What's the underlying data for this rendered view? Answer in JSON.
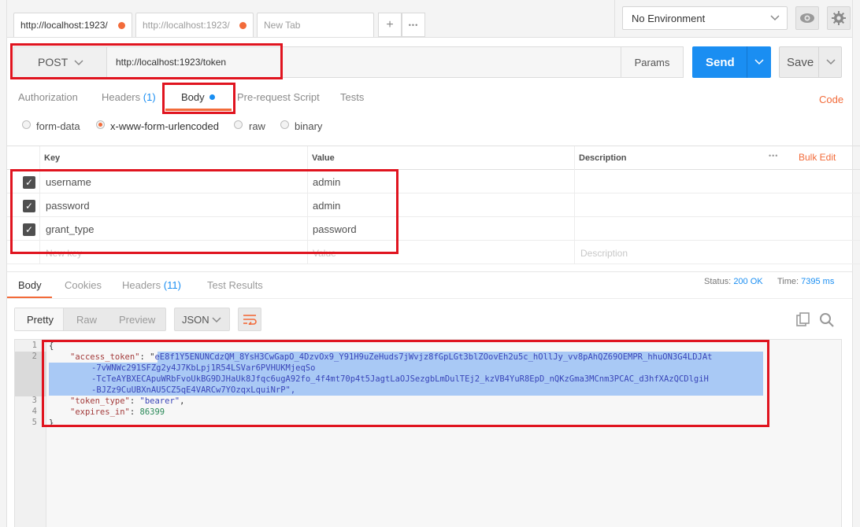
{
  "tabs": [
    {
      "label": "http://localhost:1923/",
      "modified": true
    },
    {
      "label": "http://localhost:1923/",
      "modified": true
    },
    {
      "label": "New Tab",
      "modified": false
    }
  ],
  "tab_actions": {
    "add": "+",
    "more": "•••"
  },
  "environment": {
    "selected": "No Environment"
  },
  "request": {
    "method": "POST",
    "url": "http://localhost:1923/token",
    "params_label": "Params",
    "send_label": "Send",
    "save_label": "Save"
  },
  "request_tabs": [
    {
      "label": "Authorization"
    },
    {
      "label": "Headers",
      "count": "(1)"
    },
    {
      "label": "Body"
    },
    {
      "label": "Pre-request Script"
    },
    {
      "label": "Tests"
    }
  ],
  "code_link": "Code",
  "body_types": [
    "form-data",
    "x-www-form-urlencoded",
    "raw",
    "binary"
  ],
  "body_type_selected": "x-www-form-urlencoded",
  "kv_table": {
    "headers": {
      "key": "Key",
      "value": "Value",
      "description": "Description"
    },
    "bulk_edit": "Bulk Edit",
    "more": "•••",
    "rows": [
      {
        "key": "username",
        "value": "admin",
        "checked": true
      },
      {
        "key": "password",
        "value": "admin",
        "checked": true
      },
      {
        "key": "grant_type",
        "value": "password",
        "checked": true
      }
    ],
    "placeholder": {
      "key": "New key",
      "value": "Value",
      "description": "Description"
    }
  },
  "response_tabs": [
    {
      "label": "Body"
    },
    {
      "label": "Cookies"
    },
    {
      "label": "Headers",
      "count": "(11)"
    },
    {
      "label": "Test Results"
    }
  ],
  "status": {
    "label": "Status:",
    "value": "200 OK",
    "time_label": "Time:",
    "time_value": "7395 ms"
  },
  "view_modes": [
    "Pretty",
    "Raw",
    "Preview"
  ],
  "format": "JSON",
  "code_lines": {
    "l1": "{",
    "l2_key": "\"access_token\"",
    "l2_sep": ": \"",
    "l2_val1": "eE8f1Y5ENUNCdzQM_8YsH3CwGapO_4DzvOx9_Y91H9uZeHuds7jWvjz8fGpLGt3blZOovEh2u5c_hOllJy_vv8pAhQZ69OEMPR_hhuON3G4LDJAt",
    "l2_val2": "-7vWNWc291SFZg2y4J7KbLpj1R54LSVar6PVHUKMjeqSo",
    "l2_val3": "-TcTeAYBXECApuWRbFvoUkBG9DJHaUk8Jfqc6ugA92fo_4f4mt70p4t5JagtLaOJSezgbLmDulTEj2_kzVB4YuR8EpD_nQKzGma3MCnm3PCAC_d3hfXAzQCDlgiH",
    "l2_val4": "-BJZz9CuUBXnAU5CZ5qE4VARCw7YOzqxLquiNrP",
    "l2_end": "\",",
    "l3_key": "\"token_type\"",
    "l3_sep": ": ",
    "l3_val": "\"bearer\"",
    "l3_end": ",",
    "l4_key": "\"expires_in\"",
    "l4_sep": ": ",
    "l4_val": "86399",
    "l5": "}"
  },
  "line_numbers": [
    "1",
    "2",
    "3",
    "4",
    "5"
  ],
  "colors": {
    "accent": "#f26b3a",
    "primary": "#1a8ef2",
    "annotation": "#e0141f"
  }
}
